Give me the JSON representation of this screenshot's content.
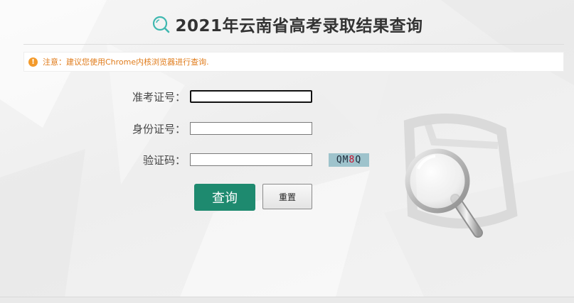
{
  "header": {
    "title": "2021年云南省高考录取结果查询",
    "icon": "search-icon",
    "accent_color": "#3fb8b0"
  },
  "notice": {
    "icon": "exclamation-icon",
    "icon_glyph": "!",
    "text": "注意：建议您使用Chrome内核浏览器进行查询.",
    "color": "#e07b1a"
  },
  "form": {
    "exam_number": {
      "label": "准考证号：",
      "value": ""
    },
    "id_number": {
      "label": "身份证号：",
      "value": ""
    },
    "captcha": {
      "label": "验证码：",
      "value": "",
      "image_chars": [
        "Q",
        "M",
        "8",
        "Q"
      ],
      "highlight_color": "#c8102e"
    }
  },
  "buttons": {
    "query_label": "查询",
    "query_color": "#1e8a6f",
    "reset_label": "重置"
  }
}
